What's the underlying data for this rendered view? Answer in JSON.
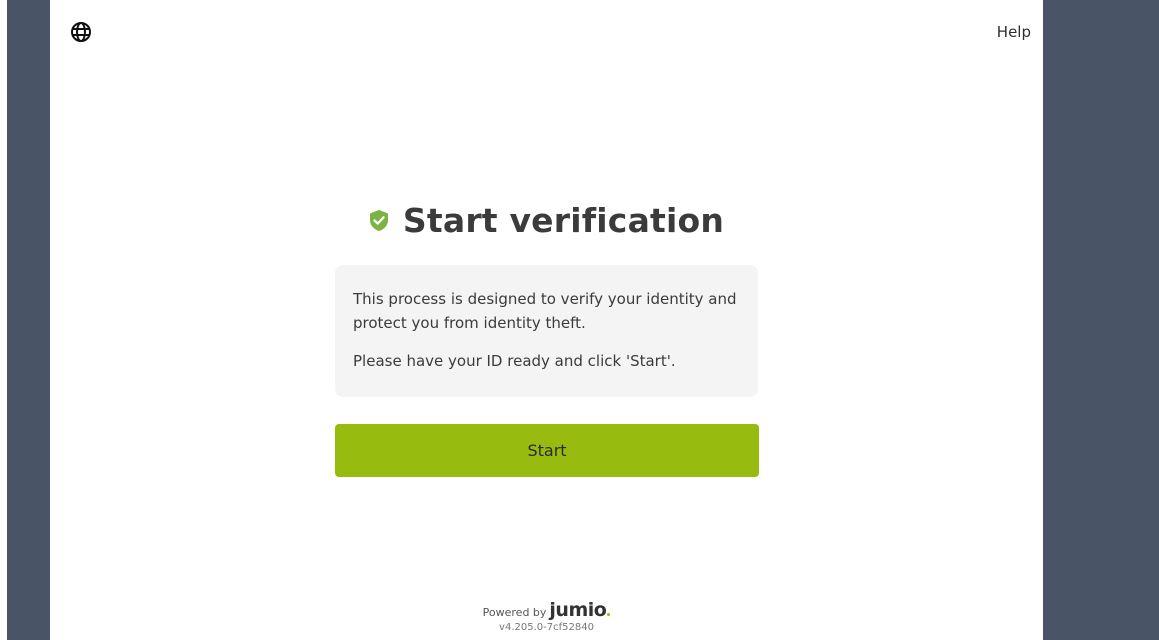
{
  "header": {
    "language_icon": "globe-icon",
    "help_label": "Help"
  },
  "main": {
    "title_icon": "shield-check-icon",
    "title": "Start verification",
    "info_line_1": "This process is designed to verify your identity and protect you from identity theft.",
    "info_line_2": "Please have your ID ready and click 'Start'.",
    "start_label": "Start"
  },
  "footer": {
    "powered_by": "Powered by",
    "brand": "jumio",
    "version": "v4.205.0-7cf52840"
  },
  "colors": {
    "accent": "#97bb0e",
    "shield": "#7cb342",
    "side_background": "#4a5467",
    "info_box_background": "#f4f4f4"
  }
}
